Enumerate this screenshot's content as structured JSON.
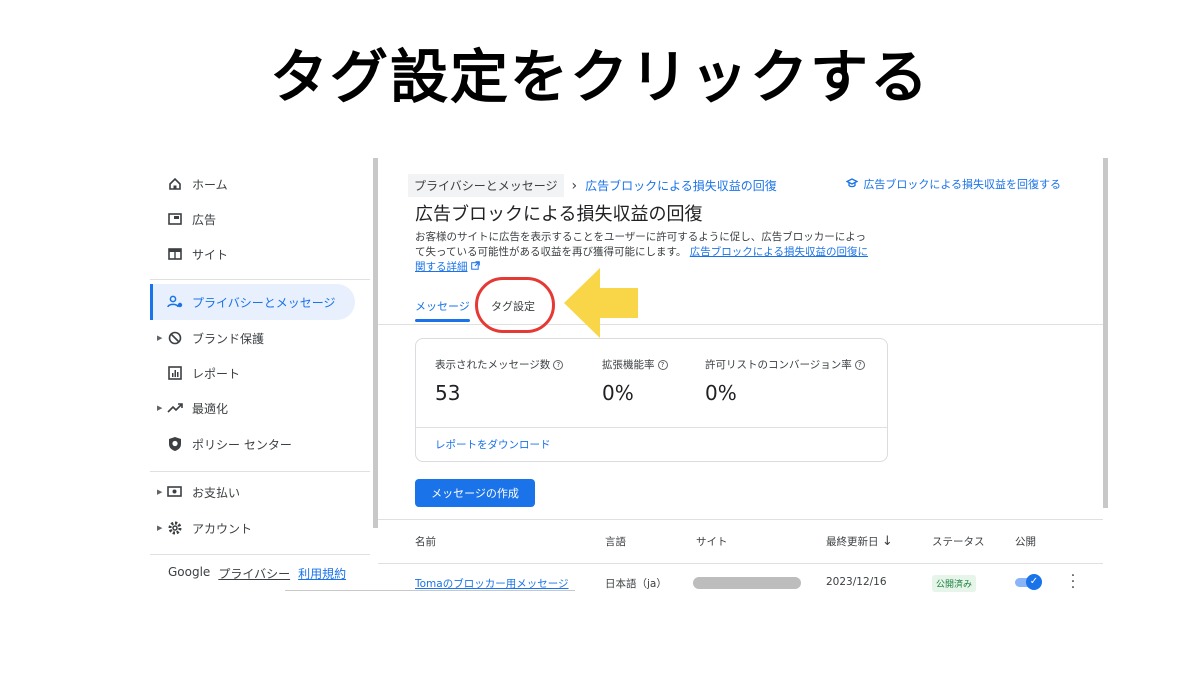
{
  "headline": "タグ設定をクリックする",
  "sidebar": {
    "items": [
      {
        "label": "ホーム",
        "icon": "home-icon"
      },
      {
        "label": "広告",
        "icon": "ads-icon"
      },
      {
        "label": "サイト",
        "icon": "site-icon"
      },
      {
        "label": "プライバシーとメッセージ",
        "icon": "privacy-icon",
        "active": true
      },
      {
        "label": "ブランド保護",
        "icon": "block-icon",
        "expandable": true
      },
      {
        "label": "レポート",
        "icon": "report-icon"
      },
      {
        "label": "最適化",
        "icon": "trend-icon",
        "expandable": true
      },
      {
        "label": "ポリシー センター",
        "icon": "policy-icon"
      },
      {
        "label": "お支払い",
        "icon": "payment-icon",
        "expandable": true
      },
      {
        "label": "アカウント",
        "icon": "gear-icon",
        "expandable": true
      }
    ],
    "footer": {
      "google": "Google",
      "privacy": "プライバシー",
      "terms": "利用規約"
    }
  },
  "breadcrumb": {
    "parent": "プライバシーとメッセージ",
    "current": "広告ブロックによる損失収益の回復"
  },
  "top_right_link": "広告ブロックによる損失収益を回復する",
  "page_title": "広告ブロックによる損失収益の回復",
  "description": {
    "line1": "お客様のサイトに広告を表示することをユーザーに許可するように促し、広告ブロッカーによっ",
    "line2_text": "て失っている可能性がある収益を再び獲得可能にします。",
    "line2_link": "広告ブロックによる損失収益の回復に",
    "line3_link": "関する詳細"
  },
  "tabs": {
    "messages": "メッセージ",
    "tag_settings": "タグ設定"
  },
  "stats": {
    "displayed_label": "表示されたメッセージ数",
    "displayed_value": "53",
    "extension_label": "拡張機能率",
    "extension_value": "0%",
    "allowlist_label": "許可リストのコンバージョン率",
    "allowlist_value": "0%",
    "download_link": "レポートをダウンロード"
  },
  "create_button": "メッセージの作成",
  "table": {
    "headers": {
      "name": "名前",
      "language": "言語",
      "site": "サイト",
      "updated": "最終更新日",
      "status": "ステータス",
      "published": "公開"
    },
    "rows": [
      {
        "name": "Tomaのブロッカー用メッセージ",
        "language": "日本語（ja）",
        "updated": "2023/12/16",
        "status": "公開済み",
        "published": true
      }
    ]
  },
  "colors": {
    "accent": "#1a73e8",
    "highlight_circle": "#e53935",
    "arrow": "#f9d548"
  }
}
